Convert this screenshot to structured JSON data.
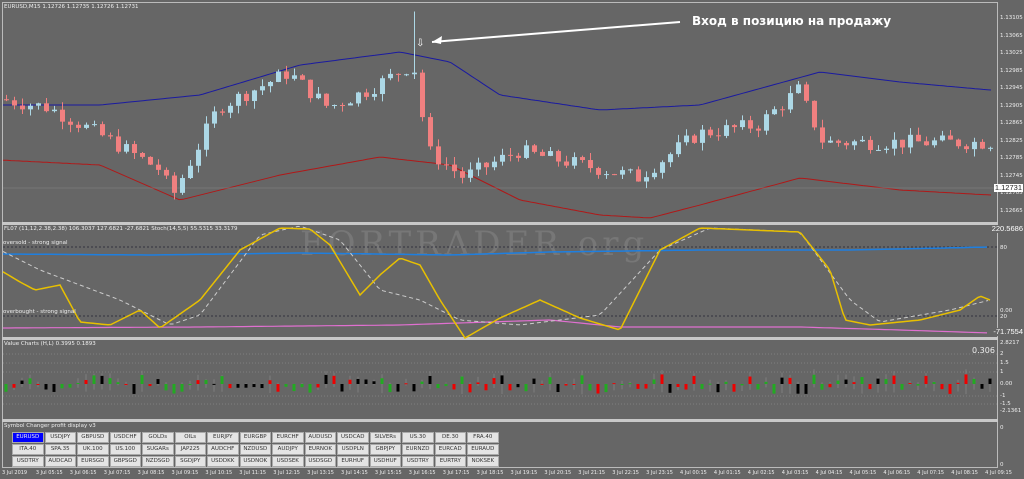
{
  "chart": {
    "symbol_header": "EURUSD,M15  1.12726 1.12735 1.12726 1.12731",
    "annotation": "Вход в позицию на продажу",
    "current_price": "1.12731",
    "price_axis": [
      "1.13105",
      "1.13065",
      "1.13025",
      "1.12985",
      "1.12945",
      "1.12905",
      "1.12865",
      "1.12825",
      "1.12785",
      "1.12745",
      "1.12705",
      "1.12665"
    ],
    "price_keypoints": [
      [
        0,
        1.1292
      ],
      [
        50,
        1.129
      ],
      [
        100,
        1.1284
      ],
      [
        160,
        1.1276
      ],
      [
        175,
        1.127
      ],
      [
        220,
        1.129
      ],
      [
        290,
        1.1298
      ],
      [
        330,
        1.129
      ],
      [
        370,
        1.1294
      ],
      [
        415,
        1.13
      ],
      [
        430,
        1.128
      ],
      [
        465,
        1.1274
      ],
      [
        520,
        1.128
      ],
      [
        600,
        1.1276
      ],
      [
        640,
        1.1274
      ],
      [
        700,
        1.1284
      ],
      [
        760,
        1.1286
      ],
      [
        800,
        1.1294
      ],
      [
        825,
        1.1282
      ],
      [
        900,
        1.1282
      ],
      [
        990,
        1.1282
      ]
    ],
    "colors": {
      "bull": "#add8e6",
      "bear": "#f08080",
      "upper_band": "#1a1aa0",
      "lower_band": "#b01818"
    }
  },
  "indicator": {
    "header": "FL07 (11,12,2.38,2.38) 106.3037 127.6821 -27.6821  Stoch(14,5,5) 55.5315 33.3179",
    "oversold_label": "oversold - strong signal",
    "overbought_label": "overbought - strong signal",
    "axis": {
      "top": "220.5686",
      "l80": "80",
      "l0": "0.00",
      "l20": "20",
      "bottom": "-71.7554"
    }
  },
  "value_charts": {
    "header": "Value Charts (H,L) 0.3995 0.1893",
    "value": "0.306",
    "axis": [
      "2.8217",
      "2",
      "1.5",
      "1",
      "0.00",
      "-1",
      "-1.5",
      "-2.1361"
    ]
  },
  "symbol_changer": {
    "header": "Symbol Changer profit display v3",
    "axis_top": "0",
    "axis_bottom": "0",
    "active": "EURUSD",
    "symbols": [
      "EURUSD",
      "USDJPY",
      "GBPUSD",
      "USDCHF",
      "GOLDs",
      "OILs",
      "EURJPY",
      "EURGBP",
      "EURCHF",
      "AUDUSD",
      "USDCAD",
      "SILVERs",
      "US.30",
      "DE.30",
      "FRA.40",
      "ITA.40",
      "SPA.35",
      "UK.100",
      "US.100",
      "SUGARs",
      "JAP225",
      "AUDCHF",
      "NZDUSD",
      "AUDJPY",
      "EURNOK",
      "USDPLN",
      "GBPJPY",
      "EURNZD",
      "EURCAD",
      "EURAUD",
      "USDTRY",
      "AUDCAD",
      "EURSGD",
      "GBPSGD",
      "NZDSGD",
      "SGDJPY",
      "USDDKK",
      "USDNOK",
      "USDSEK",
      "USDSGD",
      "EURHUF",
      "USDHUF",
      "USDTRY",
      "EURTRY",
      "NOKSEK"
    ]
  },
  "time_axis": [
    "3 Jul 2019",
    "3 Jul 05:15",
    "3 Jul 06:15",
    "3 Jul 07:15",
    "3 Jul 08:15",
    "3 Jul 09:15",
    "3 Jul 10:15",
    "3 Jul 11:15",
    "3 Jul 12:15",
    "3 Jul 13:15",
    "3 Jul 14:15",
    "3 Jul 15:15",
    "3 Jul 16:15",
    "3 Jul 17:15",
    "3 Jul 18:15",
    "3 Jul 19:15",
    "3 Jul 20:15",
    "3 Jul 21:15",
    "3 Jul 22:15",
    "3 Jul 23:15",
    "4 Jul 00:15",
    "4 Jul 01:15",
    "4 Jul 02:15",
    "4 Jul 03:15",
    "4 Jul 04:15",
    "4 Jul 05:15",
    "4 Jul 06:15",
    "4 Jul 07:15",
    "4 Jul 08:15",
    "4 Jul 09:15"
  ]
}
